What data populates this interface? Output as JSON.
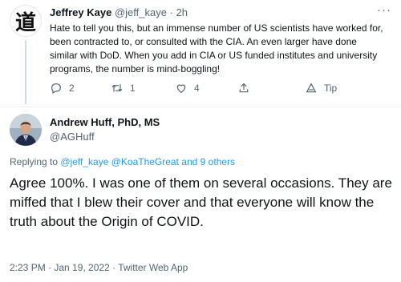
{
  "tweet1": {
    "avatar_glyph": "道",
    "author_name": "Jeffrey Kaye",
    "handle": "@jeff_kaye",
    "separator": "·",
    "time": "2h",
    "more": "···",
    "text": "Hate to tell you this, but an immense number of US scientists have worked for, been contracted to, or consulted with the CIA. An even larger have done similar with DoD. When you add in CIA or US funded institutes and university programs, the number is mind-boggling!",
    "reply_count": "2",
    "retweet_count": "1",
    "like_count": "4",
    "tip_label": "Tip"
  },
  "tweet2": {
    "author_name": "Andrew Huff, PhD, MS",
    "handle": "@AGHuff",
    "replying_prefix": "Replying to",
    "replying_users": "@jeff_kaye @KoaTheGreat",
    "replying_conj": "and",
    "replying_others": "9 others",
    "text": "Agree 100%. I was one of them on several occasions. They are miffed that I blew their cover and that everyone will know the truth about the Origin of COVID.",
    "timestamp": "2:23 PM · Jan 19, 2022 · Twitter Web App"
  },
  "colors": {
    "link": "#1d9bf0",
    "secondary_text": "#536471",
    "primary_text": "#0f1419"
  },
  "icons": [
    "reply-icon",
    "retweet-icon",
    "like-icon",
    "share-icon",
    "tip-icon",
    "more-icon"
  ]
}
